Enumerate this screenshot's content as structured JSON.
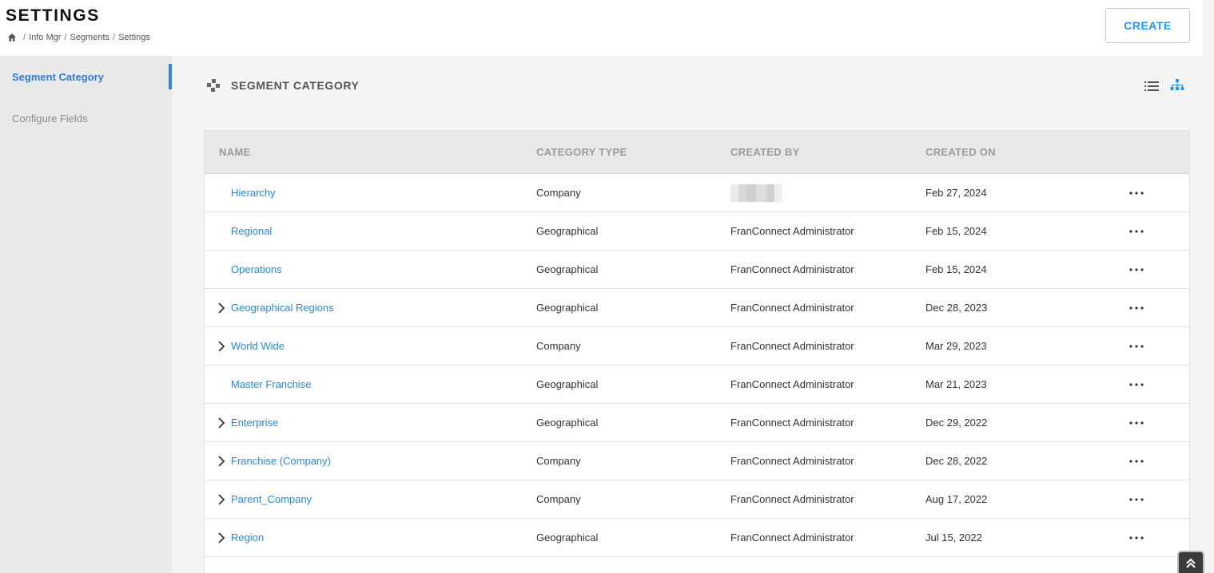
{
  "header": {
    "title": "SETTINGS",
    "breadcrumb": [
      "Info Mgr",
      "Segments",
      "Settings"
    ],
    "create_label": "CREATE"
  },
  "sidebar": {
    "items": [
      {
        "label": "Segment Category",
        "active": true
      },
      {
        "label": "Configure Fields",
        "active": false
      }
    ]
  },
  "section": {
    "title": "SEGMENT CATEGORY"
  },
  "table": {
    "columns": [
      "NAME",
      "CATEGORY TYPE",
      "CREATED BY",
      "CREATED ON"
    ],
    "rows": [
      {
        "name": "Hierarchy",
        "type": "Company",
        "created_by": "",
        "created_on": "Feb 27, 2024",
        "expandable": false
      },
      {
        "name": "Regional",
        "type": "Geographical",
        "created_by": "FranConnect Administrator",
        "created_on": "Feb 15, 2024",
        "expandable": false
      },
      {
        "name": "Operations",
        "type": "Geographical",
        "created_by": "FranConnect Administrator",
        "created_on": "Feb 15, 2024",
        "expandable": false
      },
      {
        "name": "Geographical Regions",
        "type": "Geographical",
        "created_by": "FranConnect Administrator",
        "created_on": "Dec 28, 2023",
        "expandable": true
      },
      {
        "name": "World Wide",
        "type": "Company",
        "created_by": "FranConnect Administrator",
        "created_on": "Mar 29, 2023",
        "expandable": true
      },
      {
        "name": "Master Franchise",
        "type": "Geographical",
        "created_by": "FranConnect Administrator",
        "created_on": "Mar 21, 2023",
        "expandable": false
      },
      {
        "name": "Enterprise",
        "type": "Geographical",
        "created_by": "FranConnect Administrator",
        "created_on": "Dec 29, 2022",
        "expandable": true
      },
      {
        "name": "Franchise (Company)",
        "type": "Company",
        "created_by": "FranConnect Administrator",
        "created_on": "Dec 28, 2022",
        "expandable": true
      },
      {
        "name": "Parent_Company",
        "type": "Company",
        "created_by": "FranConnect Administrator",
        "created_on": "Aug 17, 2022",
        "expandable": true
      },
      {
        "name": "Region",
        "type": "Geographical",
        "created_by": "FranConnect Administrator",
        "created_on": "Jul 15, 2022",
        "expandable": true
      }
    ]
  },
  "colors": {
    "accent": "#2196f3",
    "link": "#2389df",
    "header_bg": "#e8e8e8",
    "sidebar_bg": "#e9e9e9"
  },
  "icons": {
    "home": "home-icon",
    "section": "segment-category-icon",
    "list_view": "list-view-icon",
    "tree_view": "tree-view-icon",
    "row_expand": "chevron-right-icon",
    "row_actions": "more-horizontal-icon",
    "scroll_top": "double-chevron-up-icon"
  }
}
